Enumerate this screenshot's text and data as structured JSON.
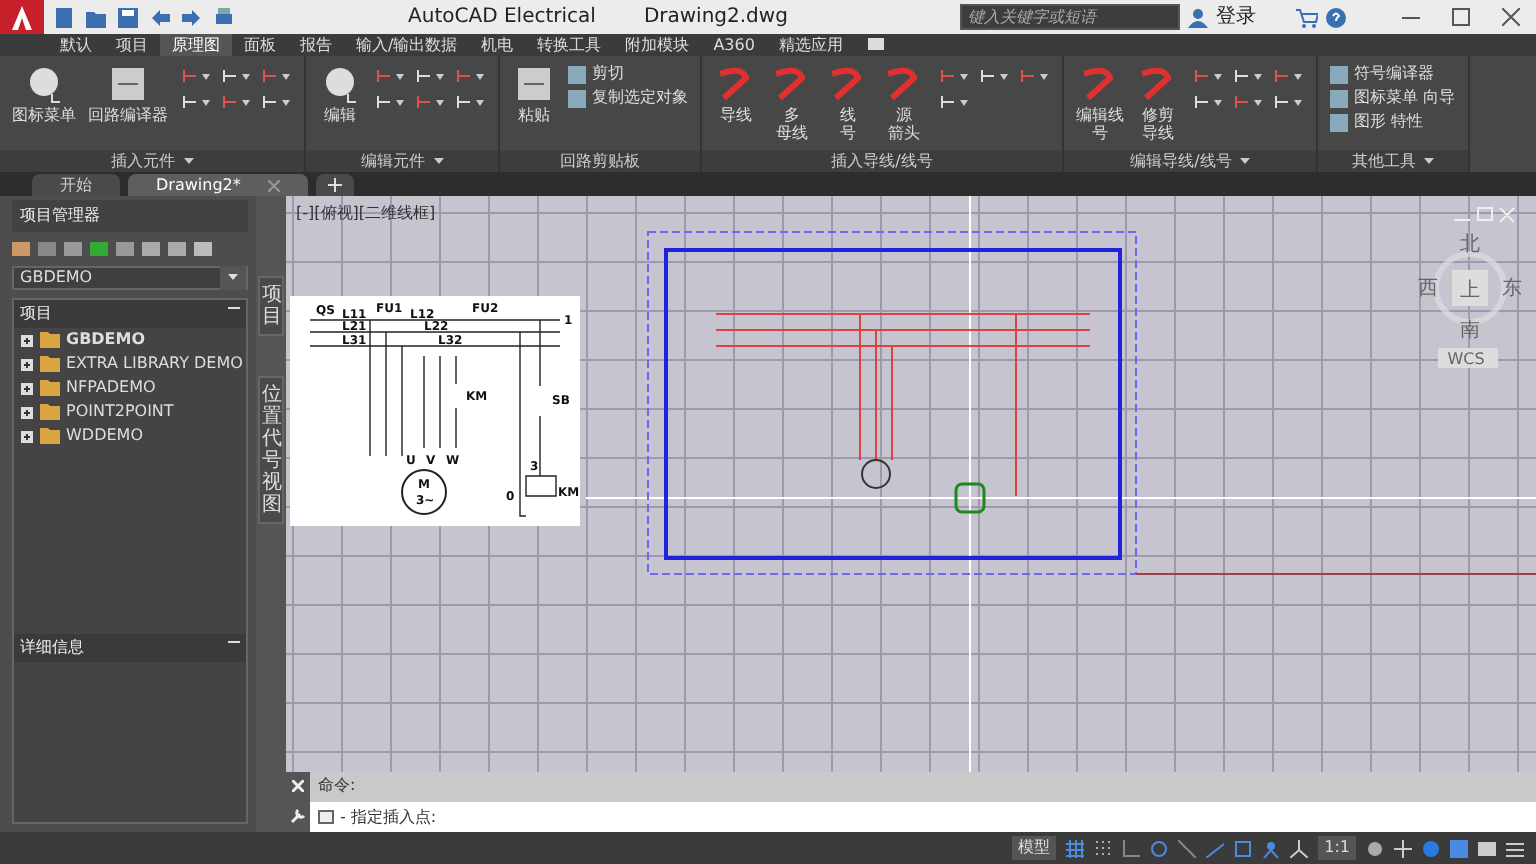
{
  "title_bar": {
    "app": "AutoCAD Electrical",
    "document": "Drawing2.dwg",
    "search": {
      "placeholder": "键入关键字或短语"
    },
    "sign_in": "登录"
  },
  "ribbon_tabs": [
    {
      "label": "默认",
      "selected": false
    },
    {
      "label": "项目",
      "selected": false
    },
    {
      "label": "原理图",
      "selected": true
    },
    {
      "label": "面板",
      "selected": false
    },
    {
      "label": "报告",
      "selected": false
    },
    {
      "label": "输入/输出数据",
      "selected": false
    },
    {
      "label": "机电",
      "selected": false
    },
    {
      "label": "转换工具",
      "selected": false
    },
    {
      "label": "附加模块",
      "selected": false
    },
    {
      "label": "A360",
      "selected": false
    },
    {
      "label": "精选应用",
      "selected": false
    }
  ],
  "ribbon_panels": [
    {
      "title": "插入元件",
      "has_menu": true,
      "big_buttons": [
        {
          "lines": [
            "图标菜单"
          ]
        },
        {
          "lines": [
            "回路编译器"
          ]
        }
      ]
    },
    {
      "title": "编辑元件",
      "has_menu": true,
      "big_buttons": [
        {
          "lines": [
            "编辑"
          ]
        }
      ]
    },
    {
      "title": "回路剪贴板",
      "has_menu": false,
      "big_buttons": [
        {
          "lines": [
            "粘贴"
          ]
        }
      ],
      "text_tools": [
        "剪切",
        "复制选定对象"
      ]
    },
    {
      "title": "插入导线/线号",
      "has_menu": false,
      "big_buttons": [
        {
          "lines": [
            "导线"
          ]
        },
        {
          "lines": [
            "多",
            "母线"
          ]
        },
        {
          "lines": [
            "线",
            "号"
          ]
        },
        {
          "lines": [
            "源",
            "箭头"
          ]
        }
      ]
    },
    {
      "title": "编辑导线/线号",
      "has_menu": true,
      "big_buttons": [
        {
          "lines": [
            "编辑线",
            "号"
          ]
        },
        {
          "lines": [
            "修剪",
            "导线"
          ]
        }
      ]
    },
    {
      "title": "其他工具",
      "has_menu": true,
      "text_tools": [
        "符号编译器",
        "图标菜单 向导",
        "图形 特性"
      ]
    }
  ],
  "document_tabs": [
    {
      "label": "开始",
      "selected": false,
      "closable": false
    },
    {
      "label": "Drawing2*",
      "selected": true,
      "closable": true
    }
  ],
  "project_manager": {
    "title": "项目管理器",
    "project": "GBDEMO",
    "tree_header": "项目",
    "projects": [
      {
        "name": "GBDEMO",
        "active": true
      },
      {
        "name": "EXTRA LIBRARY DEMO",
        "active": false
      },
      {
        "name": "NFPADEMO",
        "active": false
      },
      {
        "name": "POINT2POINT",
        "active": false
      },
      {
        "name": "WDDEMO",
        "active": false
      }
    ],
    "details_title": "详细信息"
  },
  "side_tabs": [
    "项目",
    "位置代号视图"
  ],
  "viewport": {
    "label": "[-][俯视][二维线框]",
    "schematic_labels": [
      "QS",
      "L11",
      "FU1",
      "L12",
      "FU2",
      "L21",
      "L22",
      "L31",
      "L32",
      "1",
      "KM",
      "SB",
      "U",
      "V",
      "W",
      "M",
      "3~",
      "3",
      "0",
      "KM"
    ],
    "viewcube": {
      "north": "北",
      "west": "西",
      "top": "上",
      "east": "东",
      "south": "南",
      "ucs": "WCS"
    }
  },
  "command_line": {
    "history": "命令:",
    "prompt": "- 指定插入点:"
  },
  "status_bar": {
    "space": "模型",
    "scale": "1:1"
  }
}
